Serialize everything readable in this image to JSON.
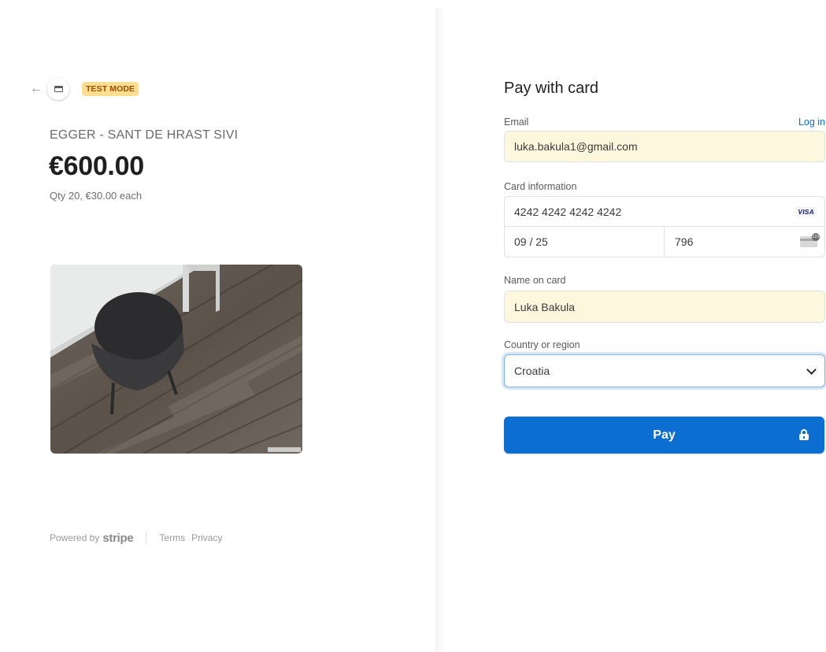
{
  "header": {
    "back_icon": "arrow-left-icon",
    "merchant_icon": "store-icon",
    "badge": "TEST MODE"
  },
  "product": {
    "name": "EGGER - SANT DE HRAST SIVI",
    "price": "€600.00",
    "qty_text": "Qty 20, €30.00 each",
    "image_alt": "wood-floor-product-photo"
  },
  "footer": {
    "powered_by": "Powered by",
    "brand": "stripe",
    "terms": "Terms",
    "privacy": "Privacy"
  },
  "form": {
    "title": "Pay with card",
    "email_label": "Email",
    "login_link": "Log in",
    "email_value": "luka.bakula1@gmail.com",
    "card_label": "Card information",
    "card_number": "4242 4242 4242 4242",
    "card_brand": "VISA",
    "expiry": "09 / 25",
    "cvc": "796",
    "name_label": "Name on card",
    "name_value": "Luka Bakula",
    "country_label": "Country or region",
    "country_value": "Croatia",
    "pay_label": "Pay"
  },
  "colors": {
    "accent": "#0c6ed1",
    "badge_bg": "#ffde92",
    "badge_text": "#9b4d00",
    "autofill_bg": "#fdf8dd"
  }
}
